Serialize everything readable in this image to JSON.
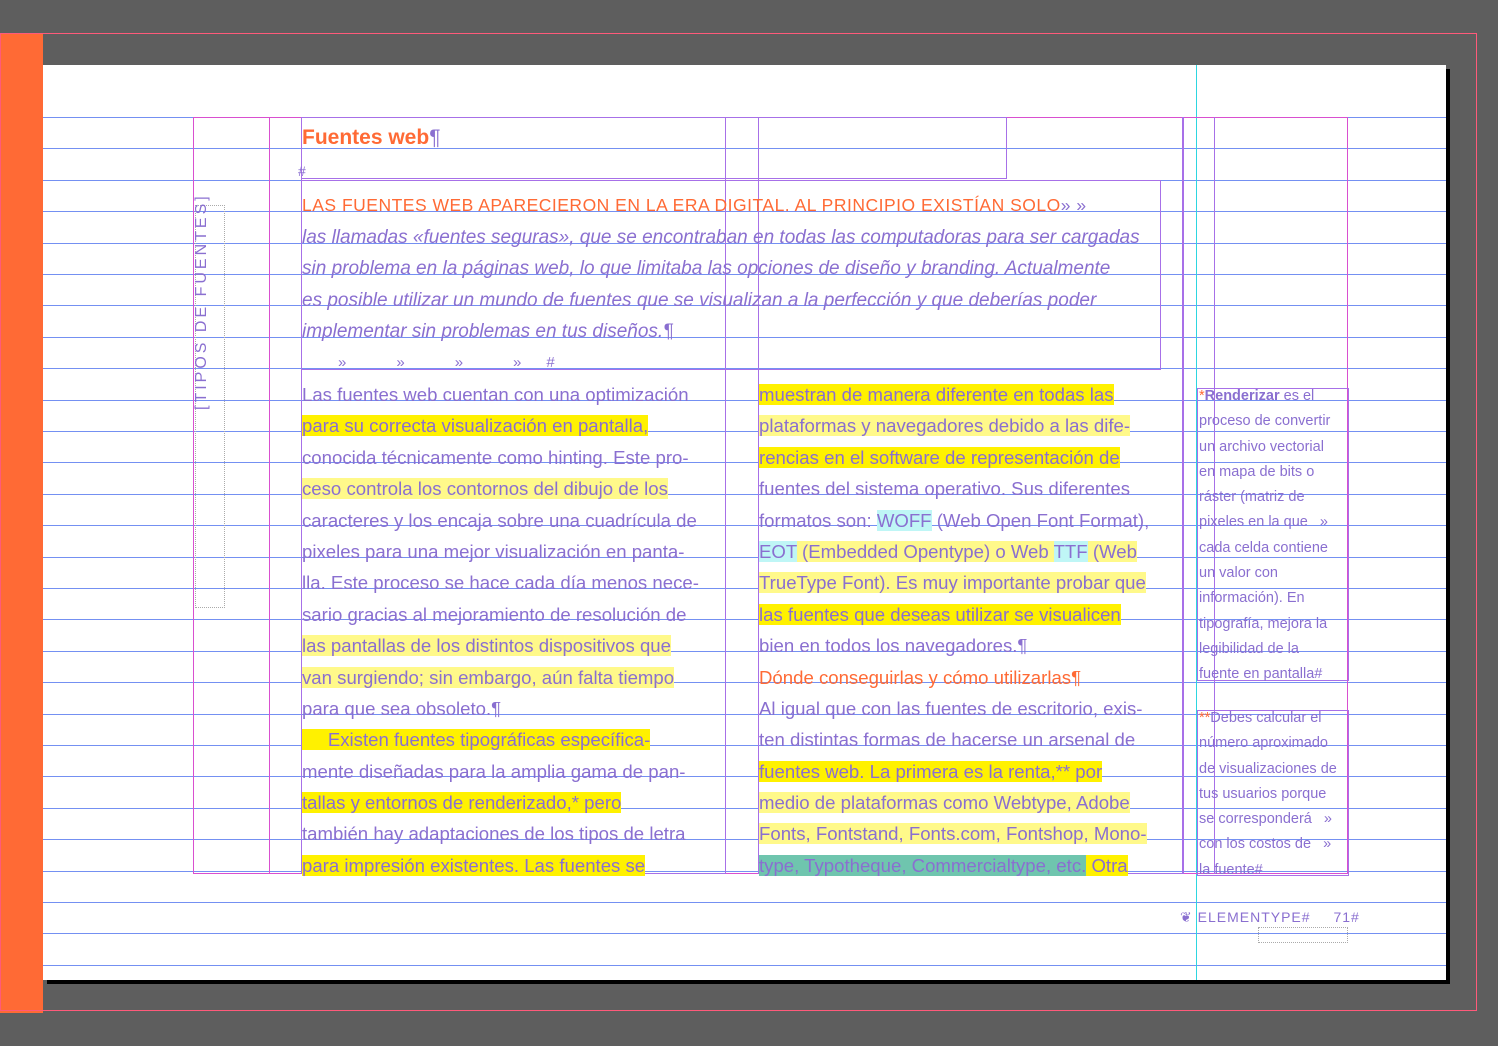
{
  "page": {
    "title": "Fuentes web",
    "title_mark": "¶",
    "hash_mark": "#",
    "sidebar_vertical": "[TIPOS DE FUENTES]",
    "lead_caps": "LAS FUENTES WEB APARECIERON EN LA ERA DIGITAL. AL PRINCIPIO EXISTÍAN SOLO",
    "lead_tab": "» »",
    "intro_lines": [
      "las llamadas «fuentes seguras», que se encontraban en todas las computadoras para ser cargadas",
      "sin problema en la páginas web, lo que limitaba las opciones de diseño y branding. Actualmente",
      "es posible utilizar un mundo de fuentes que se visualizan a la perfección y que deberías poder",
      "implementar sin problemas en tus diseños.¶"
    ],
    "tab_row": "»            »            »            »      #",
    "col1_lines": [
      "Las fuentes web cuentan con una optimización",
      "para su correcta visualización en pantalla,",
      "conocida técnicamente como hinting. Este pro-",
      "ceso controla los contornos del dibujo de los",
      "caracteres y los encaja sobre una cuadrícula de",
      "pixeles para una mejor visualización en panta-",
      "lla. Este proceso se hace cada día menos nece-",
      "sario gracias al mejoramiento de resolución de",
      "las pantallas de los distintos dispositivos que",
      "van surgiendo; sin embargo, aún falta tiempo",
      "para que sea obsoleto.¶",
      "     Existen fuentes tipográficas específica-",
      "mente diseñadas para la amplia gama de pan-",
      "tallas y entornos de renderizado,* pero",
      "también hay adaptaciones de los tipos de letra",
      "para impresión existentes. Las fuentes se"
    ],
    "col2": {
      "l1": "muestran de manera diferente en todas las",
      "l2": "plataformas y navegadores debido a las dife-",
      "l3": "rencias en el software de representación de",
      "l4": "fuentes del sistema operativo. Sus diferentes",
      "l5a": "formatos son: ",
      "l5b": "WOFF",
      "l5c": " (Web Open Font Format),",
      "l6a": "EOT",
      "l6b": " (Embedded Opentype) o Web ",
      "l6c": "TTF",
      "l6d": " (Web",
      "l7": "TrueType Font). Es muy importante probar que",
      "l8": "las fuentes que deseas utilizar se visualicen",
      "l9": "bien en todos los navegadores.¶",
      "l10": "Dónde conseguirlas y cómo utilizarlas¶",
      "l11": "Al igual que con las fuentes de escritorio, exis-",
      "l12": "ten distintas formas de hacerse un arsenal de",
      "l13": "fuentes web. La primera es la renta,** por",
      "l14": "medio de plataformas como Webtype, Adobe",
      "l15": "Fonts, Fontstand, Fonts.com, Fontshop, Mono-",
      "l16a": "type, Typotheque, Commercialtype, etc.",
      "l16b": " Otra"
    },
    "note1": {
      "star": "*",
      "bold": "Renderizar",
      "lines": [
        " es el",
        "proceso de convertir",
        "un archivo vectorial",
        "en mapa de bits o",
        "ráster (matriz de",
        "pixeles en la que   »",
        "cada celda contiene",
        "un valor con",
        "información). En",
        "tipografía, mejora la",
        "legibilidad de la",
        "fuente en pantalla#"
      ]
    },
    "note2": {
      "star": "**",
      "lines": [
        "Debes calcular el",
        "número aproximado",
        "de visualizaciones de",
        "tus usuarios porque",
        "se corresponderá   »",
        "con los costos de   »",
        "la fuente#"
      ]
    },
    "folio": {
      "brand": "ELEMENTYPE#",
      "number": "71#"
    }
  },
  "colors": {
    "accent": "#ff6a35",
    "text": "#8a6fd0",
    "highlight": "#fff100",
    "guide": "#5c7cf0"
  }
}
